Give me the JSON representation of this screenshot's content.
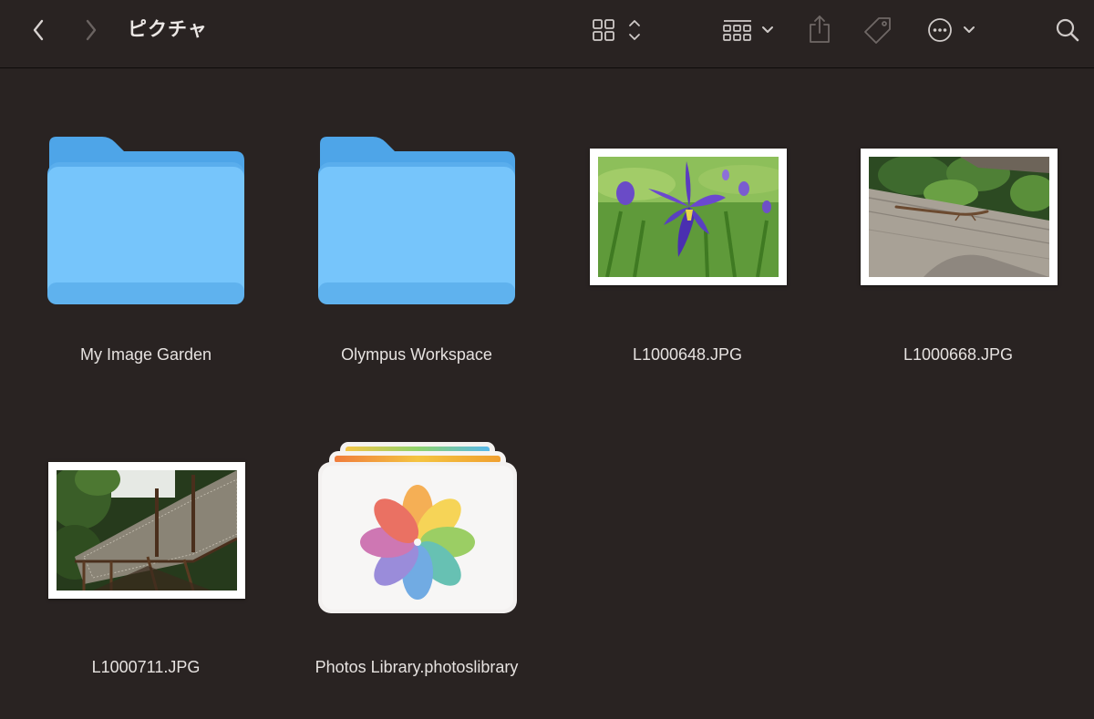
{
  "window": {
    "title": "ピクチャ"
  },
  "toolbar": {
    "back": "chevron-left-icon",
    "forward": "chevron-right-icon",
    "view_mode": "icon-grid-icon",
    "group": "group-by-icon",
    "share": "share-icon",
    "tag": "tag-icon",
    "more": "ellipsis-circle-icon",
    "search": "search-icon"
  },
  "items": [
    {
      "name": "My Image Garden",
      "kind": "folder"
    },
    {
      "name": "Olympus Workspace",
      "kind": "folder"
    },
    {
      "name": "L1000648.JPG",
      "kind": "image"
    },
    {
      "name": "L1000668.JPG",
      "kind": "image"
    },
    {
      "name": "L1000711.JPG",
      "kind": "image"
    },
    {
      "name": "Photos Library.photoslibrary",
      "kind": "photos-library"
    }
  ],
  "colors": {
    "background": "#292322",
    "folder": "#69b9f2",
    "text": "#e6e2e0"
  }
}
